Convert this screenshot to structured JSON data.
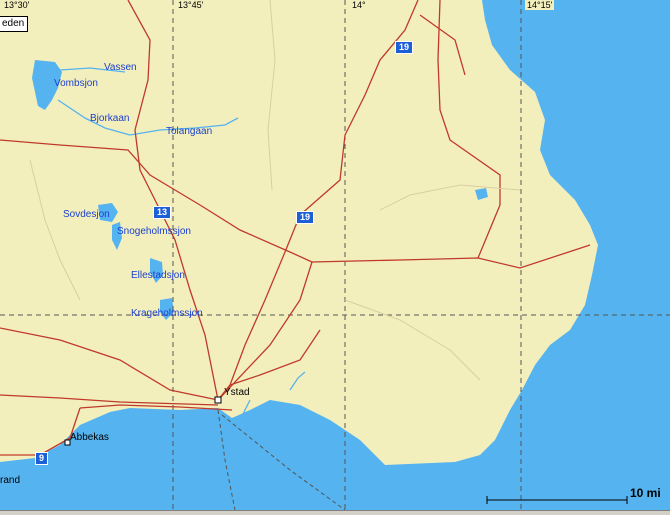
{
  "map": {
    "colors": {
      "land": "#f3efbd",
      "water": "#55b3ef",
      "road": "#c0392b",
      "grid": "#555555"
    },
    "country_tag": "eden",
    "coordinates": [
      "13°30'",
      "13°45'",
      "14°",
      "14°15'"
    ],
    "lakes": [
      "Vassen",
      "Vombsjon",
      "Bjorkaan",
      "Tolangaan",
      "Sovdesjon",
      "Snogeholmssjon",
      "Ellestadsjon",
      "Krageholmssjon"
    ],
    "towns": [
      "Ystad",
      "Abbekas"
    ],
    "partial_label": "rand",
    "road_shields": [
      "19",
      "13",
      "19",
      "9"
    ],
    "scale_label": "10 mi"
  }
}
